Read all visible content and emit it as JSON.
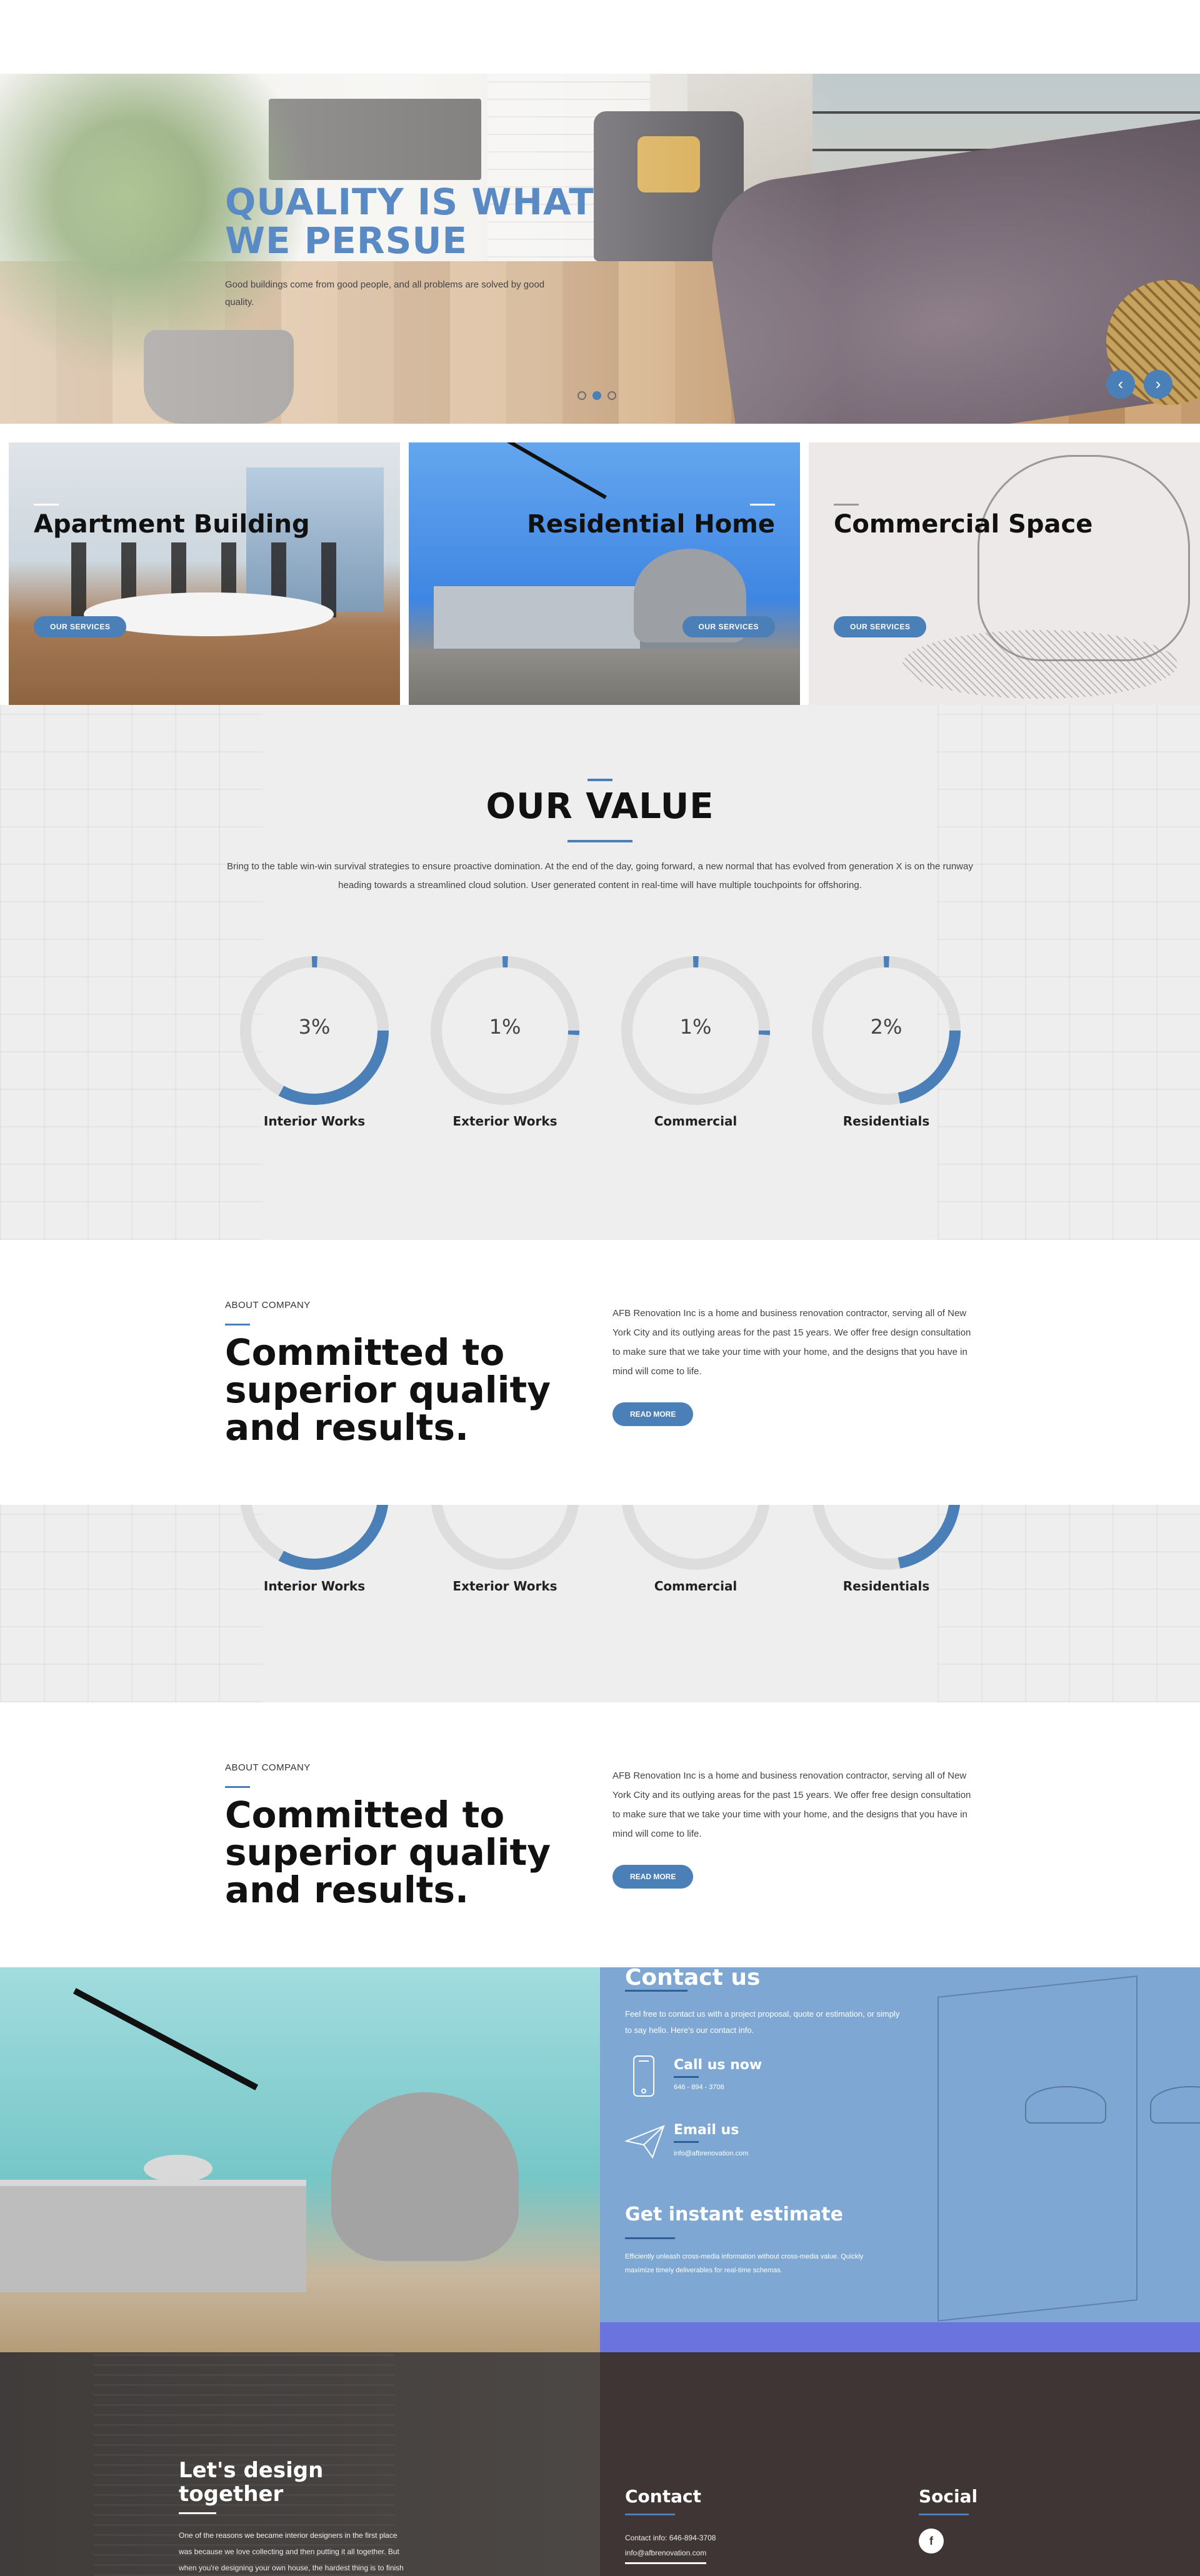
{
  "hero": {
    "title_line1": "QUALITY IS WHAT",
    "title_line2": "WE PERSUE",
    "subtitle": "Good buildings come from good people, and all problems are solved by good quality.",
    "slides": 3,
    "active_slide": 2,
    "prev_icon": "chevron-left-icon",
    "next_icon": "chevron-right-icon"
  },
  "services": [
    {
      "title": "Apartment Building",
      "button": "OUR SERVICES"
    },
    {
      "title": "Residential Home",
      "button": "OUR SERVICES"
    },
    {
      "title": "Commercial Space",
      "button": "OUR SERVICES"
    }
  ],
  "value": {
    "title": "OUR VALUE",
    "text": "Bring to the table win-win survival strategies to ensure proactive domination. At the end of the day, going forward, a new normal that has evolved from generation X is on the runway heading towards a streamlined cloud solution. User generated content in real-time will have multiple touchpoints for offshoring.",
    "circles": [
      {
        "label": "Interior Works",
        "percent_text": "3%",
        "fill": 0.33
      },
      {
        "label": "Exterior Works",
        "percent_text": "1%",
        "fill": 0.01
      },
      {
        "label": "Commercial",
        "percent_text": "1%",
        "fill": 0.01
      },
      {
        "label": "Residentials",
        "percent_text": "2%",
        "fill": 0.22
      }
    ]
  },
  "about": {
    "eyebrow": "ABOUT COMPANY",
    "title": "Committed to superior quality and results.",
    "text": "AFB Renovation Inc is a home and business renovation contractor, serving all of New York City and its outlying areas for the past 15 years. We offer free design consultation to make sure that we take your time with your home, and the designs that you have in mind will come to life.",
    "button": "READ MORE"
  },
  "contact": {
    "title": "Contact us",
    "intro": "Feel free to contact us with a project proposal, quote or estimation, or simply to say hello. Here's our contact info.",
    "call_title": "Call us now",
    "call_value": "646 - 894 - 3708",
    "email_title": "Email us",
    "email_value": "info@afbrenovation.com",
    "estimate_title": "Get instant estimate",
    "estimate_text": "Efficiently unleash cross-media information without cross-media value. Quickly maximize timely deliverables for real-time schemas.",
    "phone_icon": "phone-icon",
    "mail_icon": "paper-plane-icon"
  },
  "footer": {
    "design_title_line1": "Let's design",
    "design_title_line2": "together",
    "design_text": "One of the reasons we became interior designers in the first place was because we love collecting and then putting it all together. But when you're designing your own house, the hardest thing is to finish",
    "contact_title": "Contact",
    "contact_info": "Contact info: 646-894-3708",
    "contact_email": "info@afbrenovation.com",
    "social_title": "Social",
    "facebook_icon": "facebook-icon",
    "facebook_glyph": "f"
  },
  "colors": {
    "accent": "#4a7fb8",
    "contact_panel": "#7ea8d3",
    "contact_strip": "#6a73de",
    "footer_bg": "#3e3534",
    "ring_track": "#dddddd"
  }
}
